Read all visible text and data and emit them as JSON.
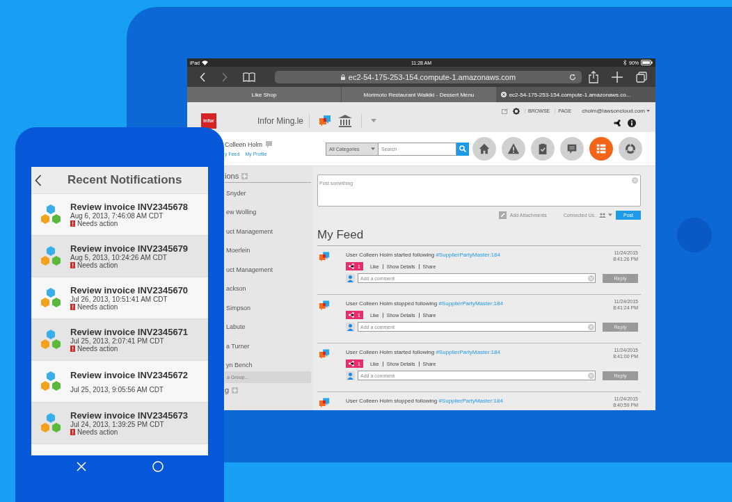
{
  "tablet": {
    "status_bar": {
      "device": "iPad",
      "time": "11:28 AM",
      "battery": "90%"
    },
    "address_bar": {
      "url": "ec2-54-175-253-154.compute-1.amazonaws.com"
    },
    "tabs": [
      {
        "label": "Like Shop",
        "selected": false
      },
      {
        "label": "Morimoto Restaurant Waikiki - Dessert Menu",
        "selected": false
      },
      {
        "label": "ec2-54-175-253-154.compute-1.amazonaws.co...",
        "selected": true
      }
    ],
    "header": {
      "logo": "infor",
      "app_name": "Infor Ming.le",
      "browse": "BROWSE",
      "page": "PAGE",
      "user_email": "cholm@lawsoncloud.com"
    },
    "profile": {
      "name": "Colleen Holm",
      "links": [
        "y Feed",
        "My Profile"
      ]
    },
    "search": {
      "category": "All Categories",
      "placeholder": "Search"
    },
    "nav_icons": [
      {
        "kind": "home",
        "selected": false
      },
      {
        "kind": "warning",
        "selected": false
      },
      {
        "kind": "clipboard",
        "selected": false
      },
      {
        "kind": "comment",
        "selected": false
      },
      {
        "kind": "list",
        "selected": true
      },
      {
        "kind": "ring",
        "selected": false
      }
    ],
    "sidebar": {
      "title": "ions",
      "items": [
        "Snyder",
        "ew Wolling",
        "uct Management",
        "Moerlein",
        "uct Management",
        "ackson",
        "Simpson",
        "Labute",
        "a Turner",
        "yn Bench"
      ],
      "group_placeholder": "a Group...",
      "section": "g"
    },
    "composer": {
      "placeholder": "Post something",
      "attach": "Add Attachments",
      "audience": "Connected Us..",
      "post": "Post"
    },
    "feed": {
      "title": "My Feed",
      "items": [
        {
          "text": "User Colleen Holm started following",
          "tag": "#SupplierPartyMaster:184",
          "date": "11/24/2015",
          "time": "8:41:26 PM",
          "count": "1",
          "actions": [
            "Like",
            "Show Details",
            "Share"
          ],
          "comment_placeholder": "Add a comment",
          "reply": "Reply"
        },
        {
          "text": "User Colleen Holm stopped following",
          "tag": "#SupplierPartyMaster:184",
          "date": "11/24/2015",
          "time": "8:41:24 PM",
          "count": "1",
          "actions": [
            "Like",
            "Show Details",
            "Share"
          ],
          "comment_placeholder": "Add a comment",
          "reply": "Reply"
        },
        {
          "text": "User Colleen Holm started following",
          "tag": "#SupplierPartyMaster:184",
          "date": "11/24/2015",
          "time": "8:41:00 PM",
          "count": "1",
          "actions": [
            "Like",
            "Show Details",
            "Share"
          ],
          "comment_placeholder": "Add a comment",
          "reply": "Reply"
        },
        {
          "text": "User Colleen Holm stopped following",
          "tag": "#SupplierPartyMaster:184",
          "date": "11/24/2015",
          "time": "8:40:59 PM"
        }
      ]
    }
  },
  "phone": {
    "title": "Recent Notifications",
    "notifications": [
      {
        "title": "Review invoice INV2345678",
        "date": "Aug 6, 2013, 7:46:08 AM CDT",
        "status": "Needs action"
      },
      {
        "title": "Review invoice INV2345679",
        "date": "Aug 5, 2013, 10:24:26 AM CDT",
        "status": "Needs action"
      },
      {
        "title": "Review invoice INV2345670",
        "date": "Jul 26, 2013, 10:51:41 AM CDT",
        "status": "Needs action"
      },
      {
        "title": "Review invoice INV2345671",
        "date": "Jul 25, 2013, 2:07:41 PM CDT",
        "status": "Needs action"
      },
      {
        "title": "Review invoice INV2345672",
        "date": "Jul 25, 2013, 9:05:56 AM CDT"
      },
      {
        "title": "Review invoice INV2345673",
        "date": "Jul 24, 2013, 1:39:25 PM CDT",
        "status": "Needs action"
      }
    ]
  }
}
